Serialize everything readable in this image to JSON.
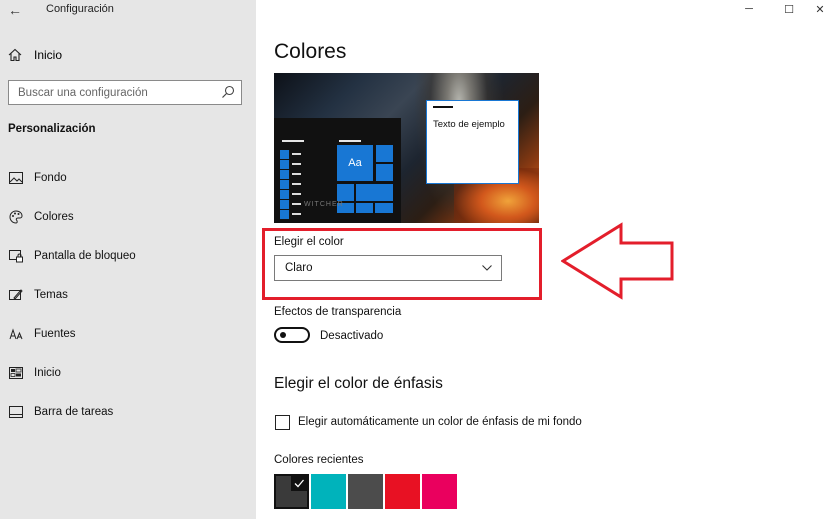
{
  "window": {
    "title": "Configuración",
    "back_glyph": "←",
    "minimize_glyph": "─",
    "maximize_glyph": "☐",
    "close_glyph": "✕"
  },
  "sidebar": {
    "home_label": "Inicio",
    "search_placeholder": "Buscar una configuración",
    "section_title": "Personalización",
    "items": [
      {
        "label": "Fondo",
        "icon": "image-icon"
      },
      {
        "label": "Colores",
        "icon": "palette-icon"
      },
      {
        "label": "Pantalla de bloqueo",
        "icon": "lock-screen-icon"
      },
      {
        "label": "Temas",
        "icon": "themes-icon"
      },
      {
        "label": "Fuentes",
        "icon": "fonts-icon"
      },
      {
        "label": "Inicio",
        "icon": "start-icon"
      },
      {
        "label": "Barra de tareas",
        "icon": "taskbar-icon"
      }
    ]
  },
  "main": {
    "page_title": "Colores",
    "preview": {
      "tile_text": "Aa",
      "sample_text": "Texto de ejemplo",
      "watermark": "WITCHER"
    },
    "choose_color": {
      "label": "Elegir el color",
      "selected": "Claro"
    },
    "transparency": {
      "label": "Efectos de transparencia",
      "state": "Desactivado"
    },
    "accent_title": "Elegir el color de énfasis",
    "auto_accent_label": "Elegir automáticamente un color de énfasis de mi fondo",
    "recent_colors_label": "Colores recientes",
    "recent_colors": [
      "#3a3a3a",
      "#00b3bb",
      "#4c4c4c",
      "#e81123",
      "#ea005e"
    ]
  },
  "colors": {
    "accent": "#1877d4",
    "highlight": "#e31e2b",
    "sidebar_bg": "#e6e6e6"
  }
}
